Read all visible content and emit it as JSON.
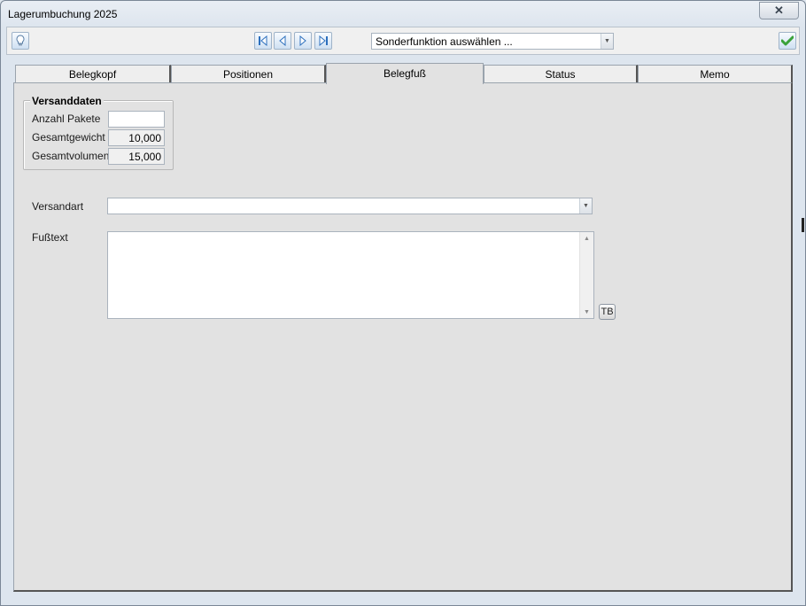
{
  "window": {
    "title": "Lagerumbuchung 2025",
    "close_icon": "close-icon"
  },
  "toolbar": {
    "help_icon": "lightbulb-icon",
    "nav": [
      "first-record-icon",
      "previous-record-icon",
      "next-record-icon",
      "last-record-icon"
    ],
    "special_function": {
      "value": "Sonderfunktion auswählen ..."
    },
    "confirm_icon": "checkmark-icon"
  },
  "tabs": [
    {
      "label": "Belegkopf"
    },
    {
      "label": "Positionen"
    },
    {
      "label": "Belegfuß",
      "active": true
    },
    {
      "label": "Status"
    },
    {
      "label": "Memo"
    }
  ],
  "versanddaten": {
    "title": "Versanddaten",
    "anzahl_pakete": {
      "label": "Anzahl Pakete",
      "value": ""
    },
    "gesamtgewicht": {
      "label": "Gesamtgewicht",
      "value": "10,000"
    },
    "gesamtvolumen": {
      "label": "Gesamtvolumen",
      "value": "15,000"
    }
  },
  "versandart": {
    "label": "Versandart",
    "value": ""
  },
  "fusstext": {
    "label": "Fußtext",
    "value": "",
    "tb_button": "TB"
  },
  "colors": {
    "accent_blue": "#2c6fbd",
    "confirm_green": "#3aa23a"
  }
}
